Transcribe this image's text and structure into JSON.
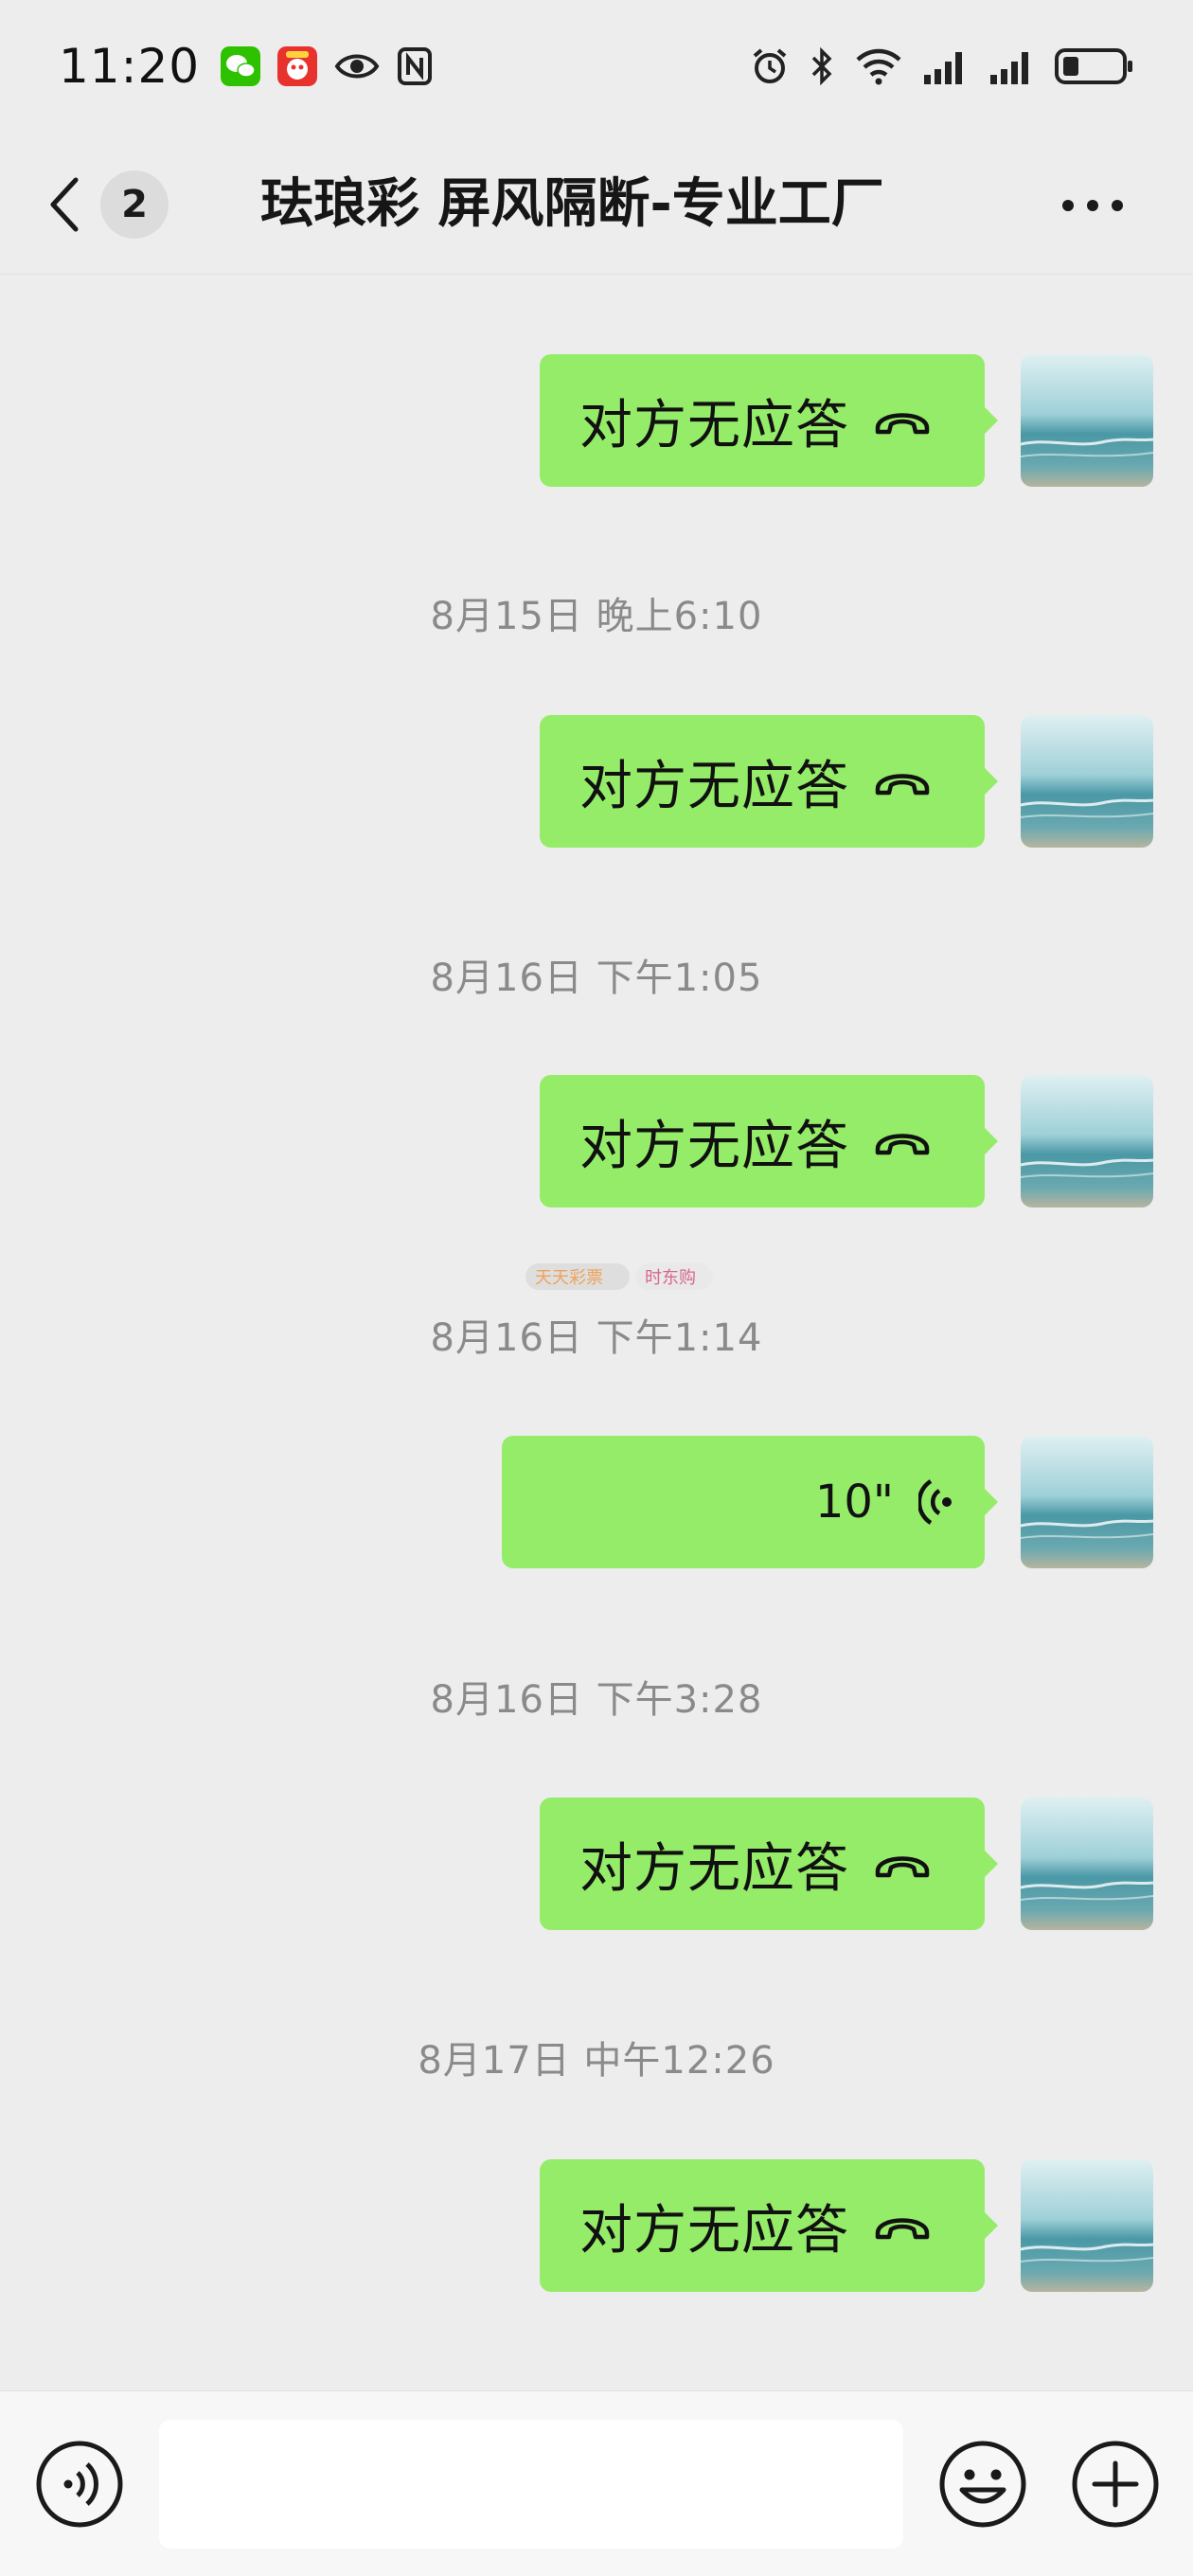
{
  "status_bar": {
    "time": "11:20",
    "icons": [
      "wechat-icon",
      "app-badge-icon",
      "eye-icon",
      "nfc-icon",
      "alarm-icon",
      "bluetooth-icon",
      "wifi-icon",
      "signal-icon",
      "signal-icon",
      "battery-icon"
    ]
  },
  "header": {
    "back_label": "<",
    "unread_count": "2",
    "title": "珐琅彩 屏风隔断-专业工厂",
    "more_icon": "more-dots-icon"
  },
  "messages": [
    {
      "type": "call",
      "text": "对方无应答",
      "icon": "hangup-phone-icon"
    },
    {
      "type": "time",
      "text": "8月15日 晚上6:10"
    },
    {
      "type": "call",
      "text": "对方无应答",
      "icon": "hangup-phone-icon"
    },
    {
      "type": "time",
      "text": "8月16日 下午1:05"
    },
    {
      "type": "call",
      "text": "对方无应答",
      "icon": "hangup-phone-icon"
    },
    {
      "type": "time",
      "text": "8月16日 下午1:14"
    },
    {
      "type": "voice",
      "duration": "10\"",
      "icon": "voice-wave-icon"
    },
    {
      "type": "time",
      "text": "8月16日 下午3:28"
    },
    {
      "type": "call",
      "text": "对方无应答",
      "icon": "hangup-phone-icon"
    },
    {
      "type": "time",
      "text": "8月17日 中午12:26"
    },
    {
      "type": "call",
      "text": "对方无应答",
      "icon": "hangup-phone-icon"
    }
  ],
  "watermark": {
    "a": "天天彩票",
    "b": "时东购",
    "c": ""
  },
  "input_bar": {
    "placeholder": "",
    "value": "",
    "icons": [
      "voice-input-icon",
      "emoji-icon",
      "plus-icon"
    ]
  },
  "colors": {
    "background": "#ededed",
    "bubble_self": "#95ec69",
    "timestamp": "#8a8a8a",
    "input_bar": "#f7f7f7"
  }
}
